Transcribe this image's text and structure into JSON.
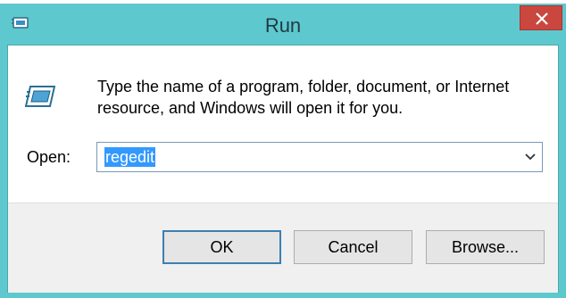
{
  "window": {
    "title": "Run",
    "close_icon": "close-icon",
    "app_icon": "run-dialog-icon"
  },
  "body": {
    "description": "Type the name of a program, folder, document, or Internet resource, and Windows will open it for you.",
    "open_label": "Open:",
    "open_value": "regedit",
    "dropdown_icon": "chevron-down-icon"
  },
  "buttons": {
    "ok_label": "OK",
    "cancel_label": "Cancel",
    "browse_label": "Browse..."
  },
  "colors": {
    "titlebar": "#5ec8cf",
    "close": "#c9473f",
    "selection": "#3399ff"
  }
}
